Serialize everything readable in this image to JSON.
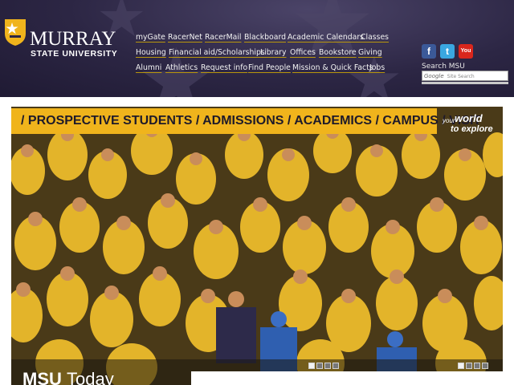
{
  "header": {
    "logo": {
      "line1": "MURRAY",
      "line2": "STATE UNIVERSITY"
    },
    "nav_row1": [
      "myGate",
      "RacerNet",
      "RacerMail",
      "Blackboard",
      "Academic Calendars",
      "Classes"
    ],
    "nav_row2": [
      "Housing",
      "Financial aid/Scholarships",
      "Library",
      "Offices",
      "Bookstore",
      "Giving"
    ],
    "nav_row3": [
      "Alumni",
      "Athletics",
      "Request info",
      "Find People",
      "Mission & Quick Facts",
      "Jobs"
    ],
    "social": [
      {
        "icon": "facebook-icon",
        "glyph": "f",
        "color": "#3b5998"
      },
      {
        "icon": "twitter-icon",
        "glyph": "t",
        "color": "#3aa7e0"
      },
      {
        "icon": "youtube-icon",
        "glyph": "You",
        "color": "#d9261c"
      }
    ],
    "search": {
      "label": "Search MSU",
      "brand": "Google",
      "placeholder": "Site Search"
    }
  },
  "hero": {
    "banner": "/ PROSPECTIVE STUDENTS / ADMISSIONS / ACADEMICS / CAMPUS / VISIT",
    "promo": {
      "prefix": "your",
      "line1": "world",
      "line2": "to explore"
    },
    "pager_top_dots": 4,
    "pager_top_active": 0,
    "pager_bottom_dots": 4,
    "pager_bottom_active": 0,
    "today_title": "MSU",
    "today_suffix": "Today"
  },
  "colors": {
    "brand_navy": "#2c2644",
    "brand_gold": "#f0b41c"
  }
}
